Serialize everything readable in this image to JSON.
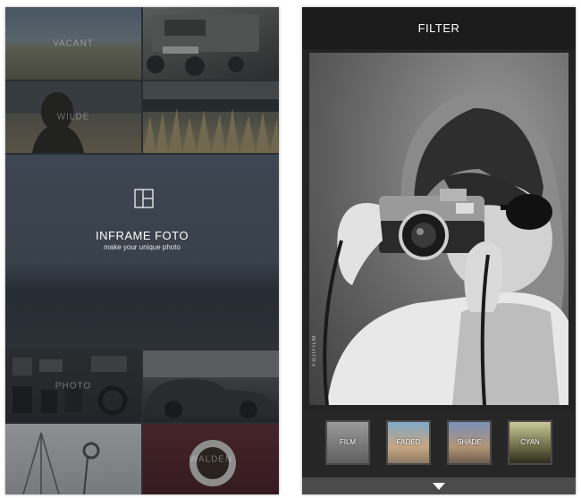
{
  "left_screen": {
    "tiles": [
      {
        "name": "tile-sky",
        "label": "VACANT"
      },
      {
        "name": "tile-car",
        "label": ""
      },
      {
        "name": "tile-girl",
        "label": "WILDE"
      },
      {
        "name": "tile-grass",
        "label": ""
      },
      {
        "name": "tile-flatlay",
        "label": "PHOTO"
      },
      {
        "name": "tile-cars",
        "label": ""
      },
      {
        "name": "tile-studio",
        "label": ""
      },
      {
        "name": "tile-coffee",
        "label": "WALDEN"
      }
    ],
    "hero": {
      "icon": "frame-layout-icon",
      "title": "INFRAME FOTO",
      "subtitle": "make your unique photo"
    }
  },
  "right_screen": {
    "header": {
      "title": "FILTER"
    },
    "photo": {
      "description_icon": "photo-preview",
      "watermark": "FUJIFILM"
    },
    "filters": [
      {
        "label": "FILM"
      },
      {
        "label": "FADED"
      },
      {
        "label": "SHADE"
      },
      {
        "label": "CYAN"
      }
    ],
    "bottom_bar": {
      "icon": "chevron-down-icon"
    }
  },
  "colors": {
    "left_bg": "#2a2e33",
    "hero_bg": "#39414b",
    "right_header": "#1b1b1b",
    "right_bg": "#232323",
    "filter_strip": "#262626",
    "bottom_bar": "#4b4b4b"
  }
}
